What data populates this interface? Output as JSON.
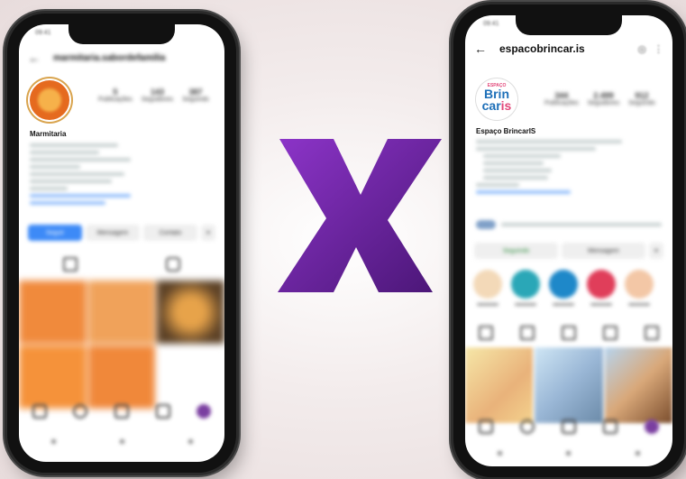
{
  "center": {
    "versus_text": "X",
    "colors": {
      "start": "#7a28b8",
      "end": "#4b1677"
    }
  },
  "left_phone": {
    "username": "marmitaria.sabordefamilia",
    "profile_name": "Marmitaria",
    "stats": [
      {
        "value": "5",
        "label": "Publicações"
      },
      {
        "value": "143",
        "label": "Seguidores"
      },
      {
        "value": "387",
        "label": "Seguindo"
      }
    ],
    "buttons": {
      "follow": "Seguir",
      "message": "Mensagem",
      "contact": "Contato"
    },
    "grid_colors": [
      "#f08a3c",
      "#f0a25a",
      "#6b4a2a",
      "#f5923a",
      "#f0883a",
      "#ffffff"
    ]
  },
  "right_phone": {
    "username": "espacobrincar.is",
    "profile_name": "Espaço BrincarIS",
    "logo": {
      "top": "ESPAÇO",
      "line1": "Brin",
      "line2a": "car",
      "line2b": "is"
    },
    "stats": [
      {
        "value": "344",
        "label": "Publicações"
      },
      {
        "value": "2.499",
        "label": "Seguidores"
      },
      {
        "value": "912",
        "label": "Seguindo"
      }
    ],
    "buttons": {
      "follow": "Seguindo",
      "message": "Mensagem"
    },
    "story_colors": [
      "#f3d9b8",
      "#2aa7b7",
      "#1e88c9",
      "#e03e5a",
      "#f3c7a6"
    ]
  },
  "status": {
    "time": "09:41"
  }
}
